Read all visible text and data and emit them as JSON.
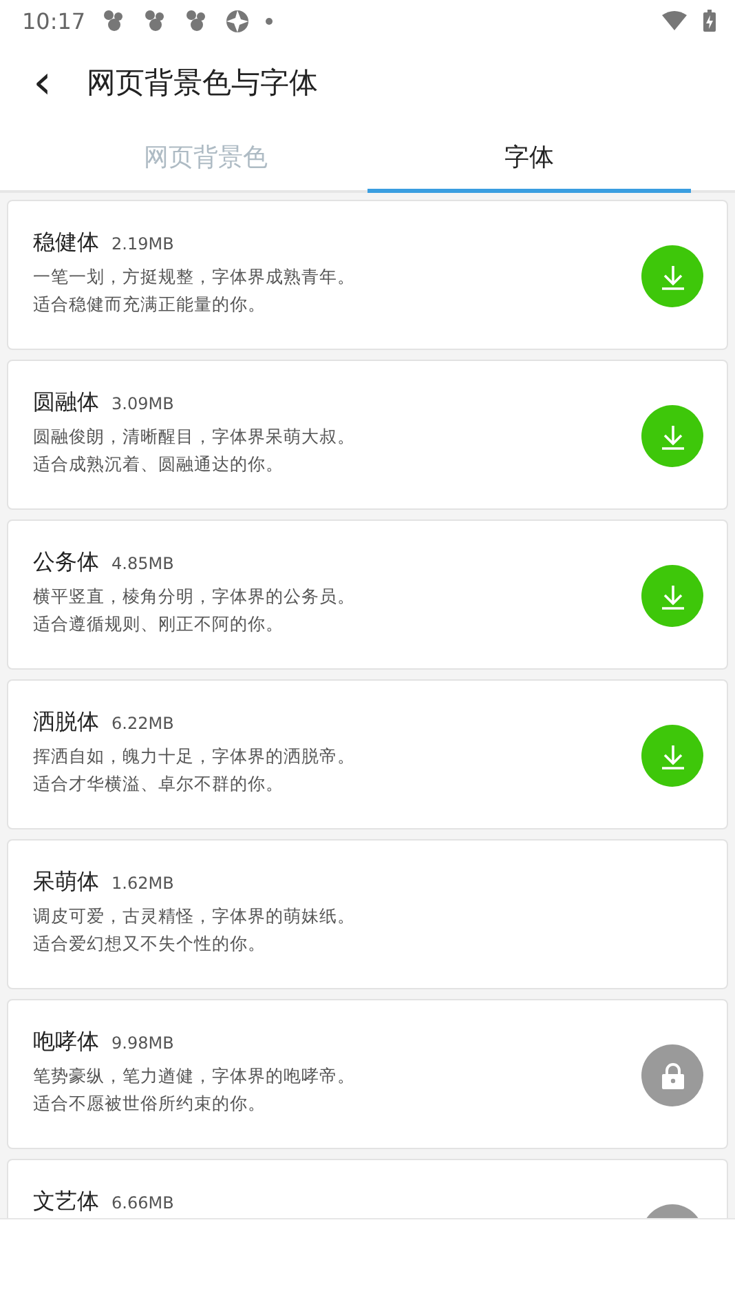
{
  "status_bar": {
    "time": "10:17"
  },
  "header": {
    "back": "‹",
    "title": "网页背景色与字体"
  },
  "tabs": [
    {
      "label": "网页背景色",
      "selected": false
    },
    {
      "label": "字体",
      "selected": true
    }
  ],
  "fonts": [
    {
      "name": "稳健体",
      "size": "2.19MB",
      "lines": [
        "一笔一划，方挺规整，字体界成熟青年。",
        "适合稳健而充满正能量的你。"
      ],
      "kind": "download"
    },
    {
      "name": "圆融体",
      "size": "3.09MB",
      "lines": [
        "圆融俊朗，清晰醒目，字体界呆萌大叔。",
        "适合成熟沉着、圆融通达的你。"
      ],
      "kind": "download"
    },
    {
      "name": "公务体",
      "size": "4.85MB",
      "lines": [
        "横平竖直，棱角分明，字体界的公务员。",
        "适合遵循规则、刚正不阿的你。"
      ],
      "kind": "download"
    },
    {
      "name": "洒脱体",
      "size": "6.22MB",
      "lines": [
        "挥洒自如，魄力十足，字体界的洒脱帝。",
        "适合才华横溢、卓尔不群的你。"
      ],
      "kind": "download"
    },
    {
      "name": "呆萌体",
      "size": "1.62MB",
      "lines": [
        "调皮可爱，古灵精怪，字体界的萌妹纸。",
        "适合爱幻想又不失个性的你。"
      ],
      "kind": "plain"
    },
    {
      "name": "咆哮体",
      "size": "9.98MB",
      "lines": [
        "笔势豪纵，笔力遒健，字体界的咆哮帝。",
        "适合不愿被世俗所约束的你。"
      ],
      "kind": "locked"
    },
    {
      "name": "文艺体",
      "size": "6.66MB",
      "kind": "locked"
    }
  ]
}
